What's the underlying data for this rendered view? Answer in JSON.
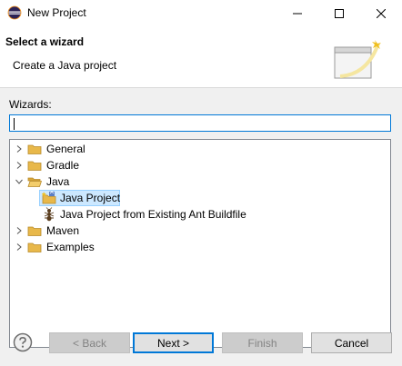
{
  "window": {
    "title": "New Project",
    "controls": {
      "minimize": "minimize",
      "maximize": "maximize",
      "close": "close"
    }
  },
  "banner": {
    "title": "Select a wizard",
    "description": "Create a Java project"
  },
  "wizards": {
    "label": "Wizards:",
    "filter_value": "",
    "tree": [
      {
        "label": "General",
        "icon": "folder-icon",
        "expanded": false,
        "level": 0
      },
      {
        "label": "Gradle",
        "icon": "folder-icon",
        "expanded": false,
        "level": 0
      },
      {
        "label": "Java",
        "icon": "folder-open-icon",
        "expanded": true,
        "level": 0
      },
      {
        "label": "Java Project",
        "icon": "java-project-icon",
        "level": 1,
        "selected": true
      },
      {
        "label": "Java Project from Existing Ant Buildfile",
        "icon": "ant-icon",
        "level": 1
      },
      {
        "label": "Maven",
        "icon": "folder-icon",
        "expanded": false,
        "level": 0
      },
      {
        "label": "Examples",
        "icon": "folder-icon",
        "expanded": false,
        "level": 0
      }
    ]
  },
  "buttons": {
    "back": "< Back",
    "next": "Next >",
    "finish": "Finish",
    "cancel": "Cancel"
  },
  "colors": {
    "selection": "#cce8ff",
    "focus": "#0078d7",
    "folder": "#e8b84a"
  }
}
